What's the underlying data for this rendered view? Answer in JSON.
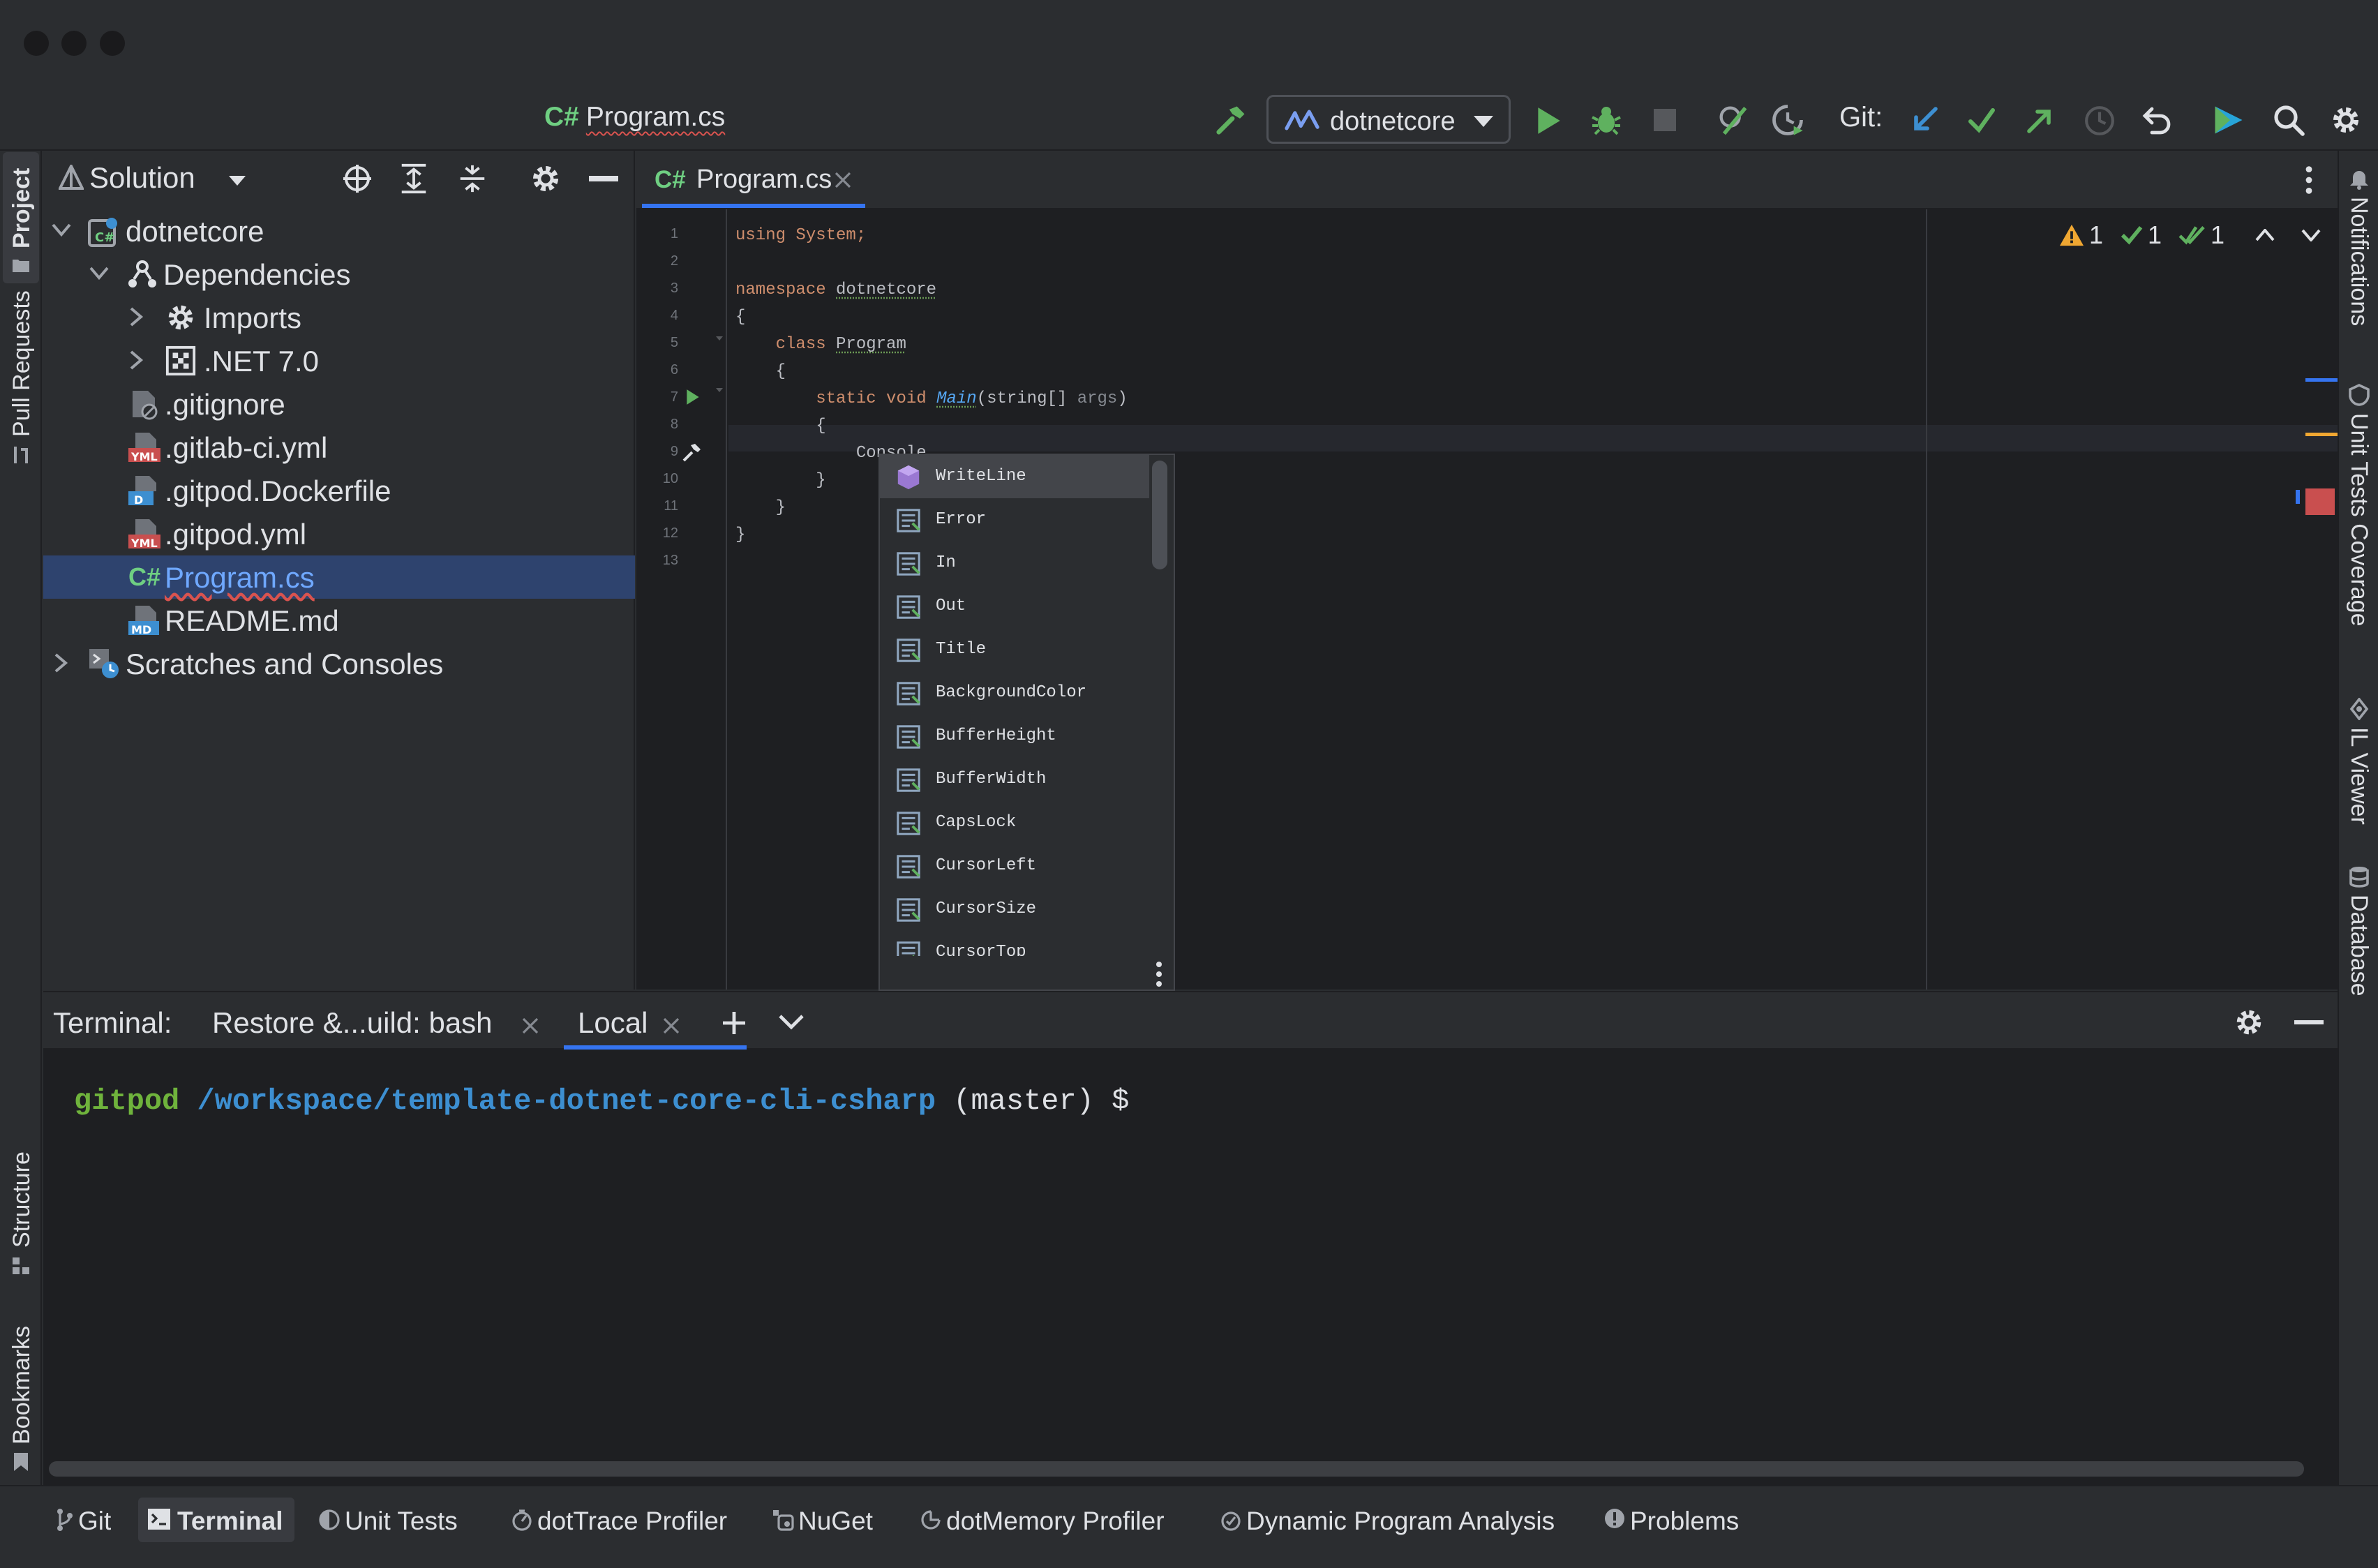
{
  "toolbar": {
    "open_file_tab": "Program.cs",
    "cs_badge": "C#",
    "run_config": "dotnetcore",
    "git_label": "Git:"
  },
  "left_strip": {
    "project": "Project",
    "pull_requests": "Pull Requests",
    "structure": "Structure",
    "bookmarks": "Bookmarks"
  },
  "right_strip": {
    "notifications": "Notifications",
    "unit_tests_coverage": "Unit Tests Coverage",
    "il_viewer": "IL Viewer",
    "database": "Database"
  },
  "project_panel": {
    "title": "Solution",
    "tree": [
      {
        "label": "dotnetcore"
      },
      {
        "label": "Dependencies"
      },
      {
        "label": "Imports"
      },
      {
        "label": ".NET 7.0"
      },
      {
        "label": ".gitignore"
      },
      {
        "label": ".gitlab-ci.yml"
      },
      {
        "label": ".gitpod.Dockerfile"
      },
      {
        "label": ".gitpod.yml"
      },
      {
        "label": "Program.cs"
      },
      {
        "label": "README.md"
      },
      {
        "label": "Scratches and Consoles"
      }
    ]
  },
  "editor": {
    "tab_label": "Program.cs",
    "line_numbers": [
      "1",
      "2",
      "3",
      "4",
      "5",
      "6",
      "7",
      "8",
      "9",
      "10",
      "11",
      "12",
      "13"
    ],
    "code": {
      "l1_kw": "using",
      "l1_rest": " System;",
      "l3_kw": "namespace",
      "l3_name": "dotnetcore",
      "l4": "{",
      "l5_kw": "class",
      "l5_name": "Program",
      "l6": "{",
      "l7_kw": "static void",
      "l7_fn": "Main",
      "l7_params": "(string[] ",
      "l7_arg": "args",
      "l7_close": ")",
      "l8": "{",
      "l9": "Console.",
      "l10": "}",
      "l11": "}",
      "l12": "}"
    },
    "inspections": {
      "warnings": "1",
      "checks": "1",
      "double_checks": "1"
    }
  },
  "completion": {
    "items": [
      "WriteLine",
      "Error",
      "In",
      "Out",
      "Title",
      "BackgroundColor",
      "BufferHeight",
      "BufferWidth",
      "CapsLock",
      "CursorLeft",
      "CursorSize",
      "CursorTop"
    ]
  },
  "terminal": {
    "label": "Terminal:",
    "tabs": [
      "Restore &...uild: bash",
      "Local"
    ],
    "prompt_user": "gitpod",
    "prompt_path": "/workspace/template-dotnet-core-cli-csharp",
    "prompt_branch": "(master)",
    "prompt_symbol": "$"
  },
  "bottom_bar": {
    "items": [
      "Git",
      "Terminal",
      "Unit Tests",
      "dotTrace Profiler",
      "NuGet",
      "dotMemory Profiler",
      "Dynamic Program Analysis",
      "Problems"
    ]
  },
  "colors": {
    "accent": "#3574f0",
    "run_green": "#5fb15f",
    "warning": "#f0a732",
    "error": "#c94f4f",
    "path_blue": "#3d8fd1",
    "user_green": "#6fb33c"
  }
}
